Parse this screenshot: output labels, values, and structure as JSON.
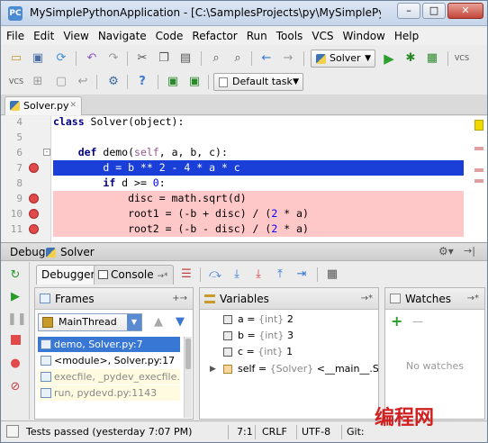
{
  "window": {
    "title": "MySimplePythonApplication - [C:\\SamplesProjects\\py\\MySimplePythonA...",
    "app_icon": "PC",
    "controls": {
      "minimize": "–",
      "maximize": "□",
      "close": "✕"
    }
  },
  "menu": [
    "File",
    "Edit",
    "View",
    "Navigate",
    "Code",
    "Refactor",
    "Run",
    "Tools",
    "VCS",
    "Window",
    "Help"
  ],
  "toolbar": {
    "run_config": "Solver",
    "default_task": "Default task",
    "vcs_label": "VCS"
  },
  "editor_tab": {
    "label": "Solver.py"
  },
  "code_lines": [
    {
      "num": "4",
      "text": "class Solver(object):",
      "state": "normal"
    },
    {
      "num": "5",
      "text": "",
      "state": "normal"
    },
    {
      "num": "6",
      "text": "    def demo(self, a, b, c):",
      "state": "normal"
    },
    {
      "num": "7",
      "text": "        d = b ** 2 - 4 * a * c",
      "state": "exec"
    },
    {
      "num": "8",
      "text": "        if d >= 0:",
      "state": "normal"
    },
    {
      "num": "9",
      "text": "            disc = math.sqrt(d)",
      "state": "bp"
    },
    {
      "num": "10",
      "text": "            root1 = (-b + disc) / (2 * a)",
      "state": "bp"
    },
    {
      "num": "11",
      "text": "            root2 = (-b - disc) / (2 * a)",
      "state": "bp"
    }
  ],
  "debug": {
    "header_label": "Debug",
    "config_name": "Solver",
    "tab_debugger": "Debugger",
    "tab_console": "Console",
    "tab_console_suffix": "→*",
    "frames_title": "Frames",
    "thread": "MainThread",
    "frames": [
      {
        "label": "demo, Solver.py:7",
        "state": "selected"
      },
      {
        "label": "<module>, Solver.py:17",
        "state": "normal"
      },
      {
        "label": "execfile, _pydev_execfile.py",
        "state": "library"
      },
      {
        "label": "run, pydevd.py:1143",
        "state": "library"
      }
    ],
    "variables_title": "Variables",
    "variables": [
      {
        "name": "a",
        "type": "{int}",
        "value": "2",
        "expandable": false
      },
      {
        "name": "b",
        "type": "{int}",
        "value": "3",
        "expandable": false
      },
      {
        "name": "c",
        "type": "{int}",
        "value": "1",
        "expandable": false
      },
      {
        "name": "self",
        "type": "{Solver}",
        "value": "<__main__.Solve",
        "expandable": true
      }
    ],
    "watches_title": "Watches",
    "watches_empty": "No watches",
    "watches_add": "+",
    "watches_remove": "—"
  },
  "status": {
    "message": "Tests passed (yesterday 7:07 PM)",
    "position": "7:1",
    "line_sep": "CRLF",
    "encoding": "UTF-8",
    "vcs": "Git:"
  },
  "watermark": "编程网",
  "colors": {
    "exec_line": "#1a3fd8",
    "breakpoint_line": "#ffc8c8",
    "selection": "#3877d4",
    "breakpoint": "#e04a4a"
  }
}
